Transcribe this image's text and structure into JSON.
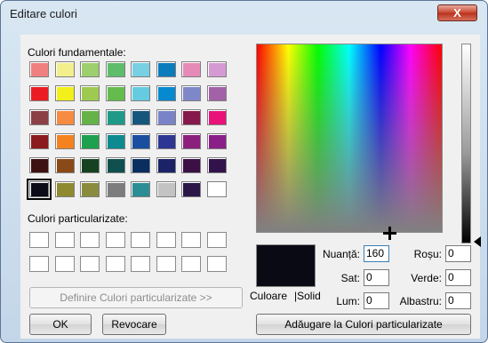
{
  "window": {
    "title": "Editare culori",
    "close_label": "X"
  },
  "basic_colors": {
    "label": "Culori fundamentale:",
    "colors": [
      "#f08080",
      "#f3ef8d",
      "#9ecf6e",
      "#5dbd6b",
      "#78d0e2",
      "#0b7cbc",
      "#e68bb8",
      "#d59ad3",
      "#ec1c24",
      "#f2ef1a",
      "#9fca51",
      "#63bc4c",
      "#64cbe0",
      "#0789cf",
      "#7e88c9",
      "#a361a8",
      "#8b4046",
      "#f68b41",
      "#65b248",
      "#1f9a88",
      "#15567d",
      "#7a83c7",
      "#86184b",
      "#e8127a",
      "#8b1a1d",
      "#f48220",
      "#1ea14e",
      "#0c8a90",
      "#1a4fa0",
      "#2d3692",
      "#8c1f7d",
      "#8a1f88",
      "#3d1111",
      "#8a4a17",
      "#154322",
      "#0f4f4e",
      "#0a2e60",
      "#1b2366",
      "#3c1044",
      "#31124a",
      "#0c0c18",
      "#8f8a2f",
      "#8b8b3e",
      "#7d7d7d",
      "#2c8e94",
      "#c3c3c3",
      "#2b1648",
      "#ffffff"
    ]
  },
  "custom_colors": {
    "label": "Culori particularizate:"
  },
  "buttons": {
    "define": "Definire Culori particularizate >>",
    "ok": "OK",
    "cancel": "Revocare",
    "add": "Adăugare la Culori particularizate"
  },
  "preview": {
    "color_label": "Culoare",
    "solid_label": "|Solid"
  },
  "fields": {
    "hue": {
      "label": "Nuanță:",
      "value": "160"
    },
    "sat": {
      "label": "Sat:",
      "value": "0"
    },
    "lum": {
      "label": "Lum:",
      "value": "0"
    },
    "red": {
      "label": "Roșu:",
      "value": "0"
    },
    "green": {
      "label": "Verde:",
      "value": "0"
    },
    "blue": {
      "label": "Albastru:",
      "value": "0"
    }
  }
}
